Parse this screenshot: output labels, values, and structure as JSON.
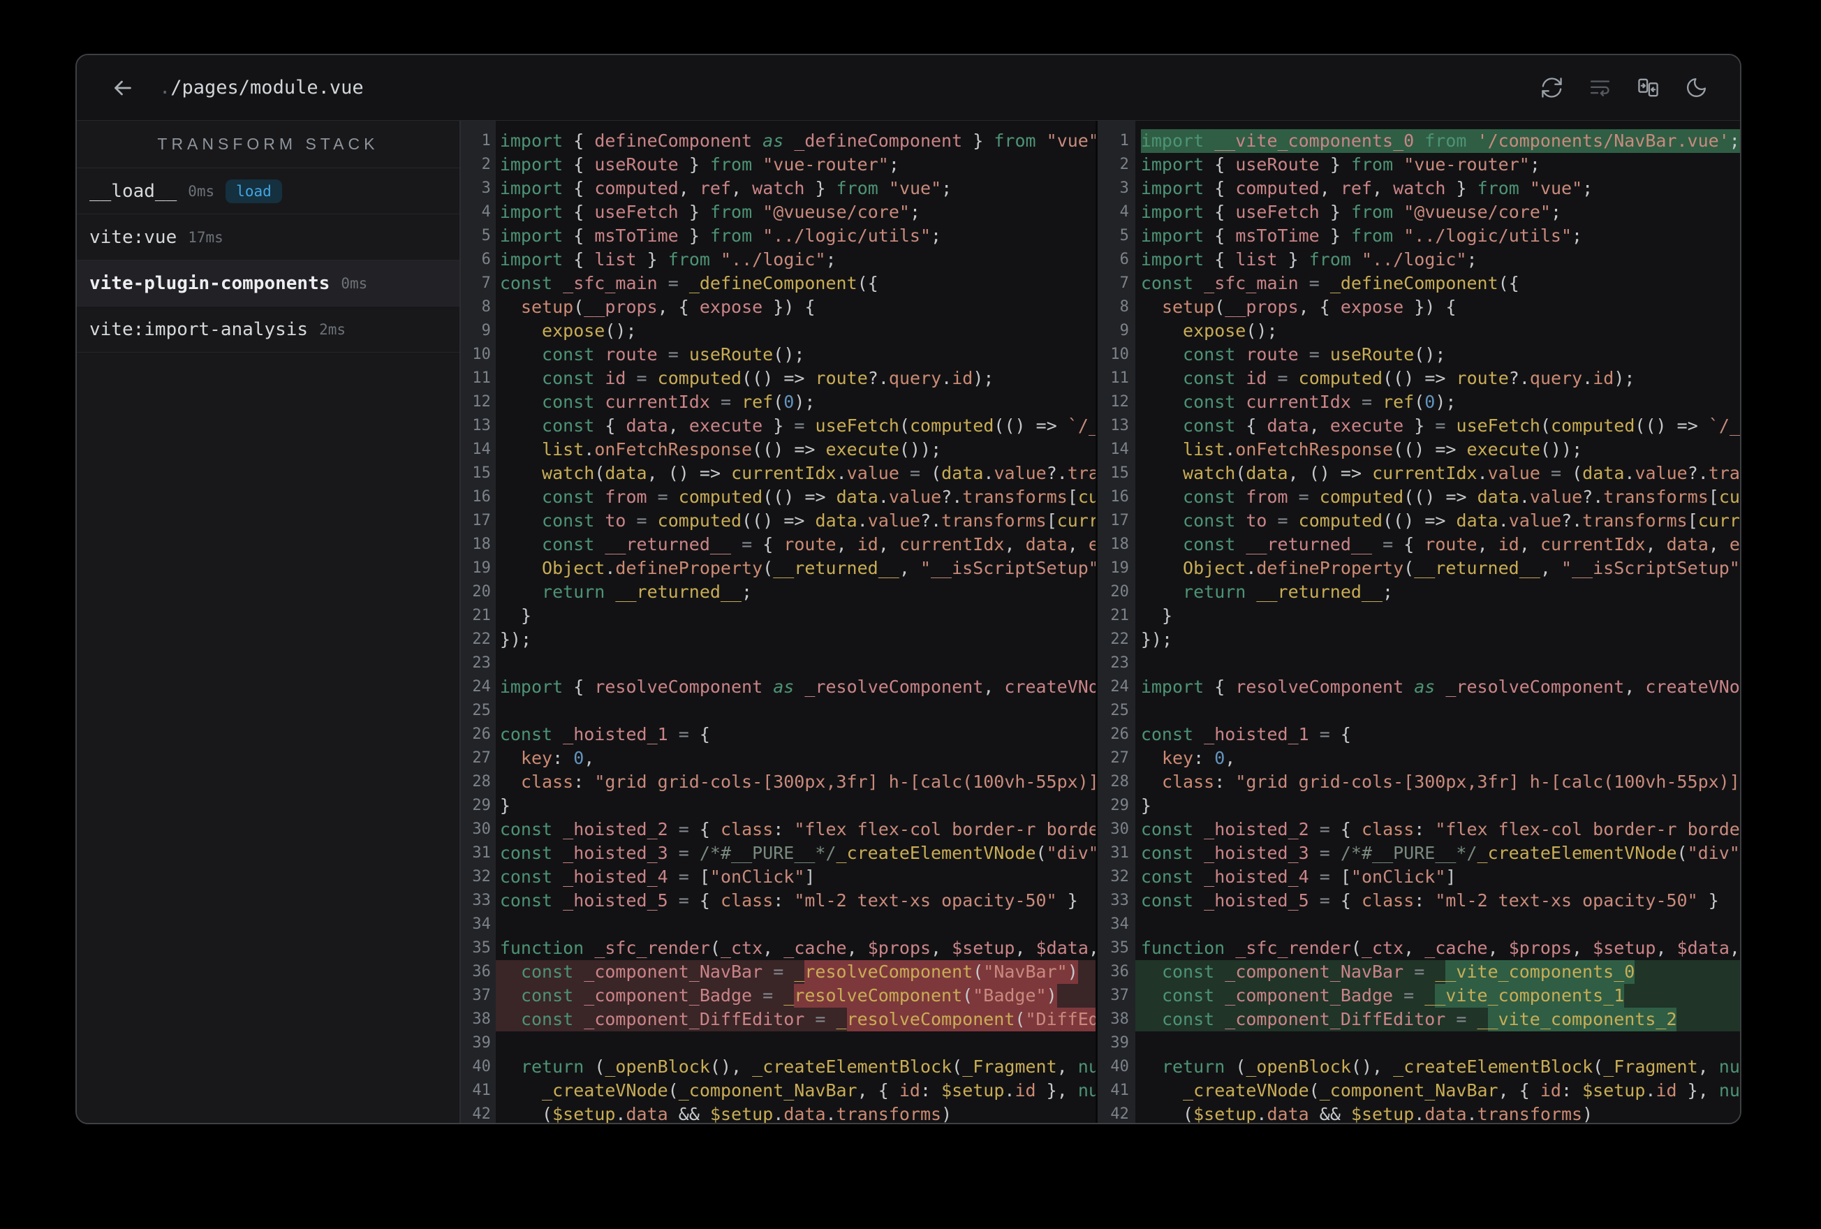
{
  "topbar": {
    "title_dot": ".",
    "title_path": "/pages/module.vue",
    "icons": [
      {
        "id": "refresh-icon",
        "dim": false
      },
      {
        "id": "wrap-lines-icon",
        "dim": true
      },
      {
        "id": "merge-panes-icon",
        "dim": false
      },
      {
        "id": "moon-icon",
        "dim": false
      }
    ]
  },
  "sidebar": {
    "header": "TRANSFORM STACK",
    "items": [
      {
        "id": "load",
        "label": "__load__",
        "time": "0ms",
        "badge": "load",
        "selected": false
      },
      {
        "id": "vite-vue",
        "label": "vite:vue",
        "time": "17ms",
        "badge": null,
        "selected": false
      },
      {
        "id": "vite-plugin-components",
        "label": "vite-plugin-components",
        "time": "0ms",
        "badge": null,
        "selected": true
      },
      {
        "id": "vite-import-analysis",
        "label": "vite:import-analysis",
        "time": "2ms",
        "badge": null,
        "selected": false
      }
    ]
  },
  "colors": {
    "badge_bg": "#15303f",
    "badge_text": "#42a5e2",
    "diff_del_line": "#3a2527",
    "diff_del_word": "#7d383c",
    "diff_add_line": "#203428",
    "diff_add_word": "#2f5e44"
  },
  "editor": {
    "left": {
      "kind": "del",
      "lines": [
        "import { defineComponent as _defineComponent } from \"vue\"",
        "import { useRoute } from \"vue-router\";",
        "import { computed, ref, watch } from \"vue\";",
        "import { useFetch } from \"@vueuse/core\";",
        "import { msToTime } from \"../logic/utils\";",
        "import { list } from \"../logic\";",
        "const _sfc_main = _defineComponent({",
        "  setup(__props, { expose }) {",
        "    expose();",
        "    const route = useRoute();",
        "    const id = computed(() => route?.query.id);",
        "    const currentIdx = ref(0);",
        "    const { data, execute } = useFetch(computed(() => `/_",
        "    list.onFetchResponse(() => execute());",
        "    watch(data, () => currentIdx.value = (data.value?.tra",
        "    const from = computed(() => data.value?.transforms[cu",
        "    const to = computed(() => data.value?.transforms[curr",
        "    const __returned__ = { route, id, currentIdx, data, e",
        "    Object.defineProperty(__returned__, \"__isScriptSetup\"",
        "    return __returned__;",
        "  }",
        "});",
        "",
        "import { resolveComponent as _resolveComponent, createVNo",
        "",
        "const _hoisted_1 = {",
        "  key: 0,",
        "  class: \"grid grid-cols-[300px,3fr] h-[calc(100vh-55px)]",
        "}",
        "const _hoisted_2 = { class: \"flex flex-col border-r borde",
        "const _hoisted_3 = /*#__PURE__*/_createElementVNode(\"div\"",
        "const _hoisted_4 = [\"onClick\"]",
        "const _hoisted_5 = { class: \"ml-2 text-xs opacity-50\" }",
        "",
        "function _sfc_render(_ctx, _cache, $props, $setup, $data,",
        "  const _component_NavBar = _resolveComponent(\"NavBar\")",
        "  const _component_Badge = _resolveComponent(\"Badge\")",
        "  const _component_DiffEditor = _resolveComponent(\"DiffEd",
        "",
        "  return (_openBlock(), _createElementBlock(_Fragment, nu",
        "    _createVNode(_component_NavBar, { id: $setup.id }, nu",
        "    ($setup.data && $setup.data.transforms)"
      ],
      "diff": {
        "36": {
          "line": true,
          "word": [
            29,
            55
          ]
        },
        "37": {
          "line": true,
          "word": [
            28,
            53
          ]
        },
        "38": {
          "line": true,
          "word": [
            33,
            58
          ]
        }
      }
    },
    "right": {
      "kind": "add",
      "lines": [
        "import __vite_components_0 from '/components/NavBar.vue';",
        "import { useRoute } from \"vue-router\";",
        "import { computed, ref, watch } from \"vue\";",
        "import { useFetch } from \"@vueuse/core\";",
        "import { msToTime } from \"../logic/utils\";",
        "import { list } from \"../logic\";",
        "const _sfc_main = _defineComponent({",
        "  setup(__props, { expose }) {",
        "    expose();",
        "    const route = useRoute();",
        "    const id = computed(() => route?.query.id);",
        "    const currentIdx = ref(0);",
        "    const { data, execute } = useFetch(computed(() => `/_",
        "    list.onFetchResponse(() => execute());",
        "    watch(data, () => currentIdx.value = (data.value?.tra",
        "    const from = computed(() => data.value?.transforms[cu",
        "    const to = computed(() => data.value?.transforms[curr",
        "    const __returned__ = { route, id, currentIdx, data, e",
        "    Object.defineProperty(__returned__, \"__isScriptSetup\"",
        "    return __returned__;",
        "  }",
        "});",
        "",
        "import { resolveComponent as _resolveComponent, createVNo",
        "",
        "const _hoisted_1 = {",
        "  key: 0,",
        "  class: \"grid grid-cols-[300px,3fr] h-[calc(100vh-55px)]",
        "}",
        "const _hoisted_2 = { class: \"flex flex-col border-r borde",
        "const _hoisted_3 = /*#__PURE__*/_createElementVNode(\"div\"",
        "const _hoisted_4 = [\"onClick\"]",
        "const _hoisted_5 = { class: \"ml-2 text-xs opacity-50\" }",
        "",
        "function _sfc_render(_ctx, _cache, $props, $setup, $data,",
        "  const _component_NavBar = __vite_components_0",
        "  const _component_Badge = __vite_components_1",
        "  const _component_DiffEditor = __vite_components_2",
        "",
        "  return (_openBlock(), _createElementBlock(_Fragment, nu",
        "    _createVNode(_component_NavBar, { id: $setup.id }, nu",
        "    ($setup.data && $setup.data.transforms)"
      ],
      "diff": {
        "1": {
          "line": false,
          "word": [
            0,
            57
          ]
        },
        "36": {
          "line": true,
          "word": [
            29,
            47
          ]
        },
        "37": {
          "line": true,
          "word": [
            28,
            46
          ]
        },
        "38": {
          "line": true,
          "word": [
            33,
            51
          ]
        }
      }
    }
  }
}
